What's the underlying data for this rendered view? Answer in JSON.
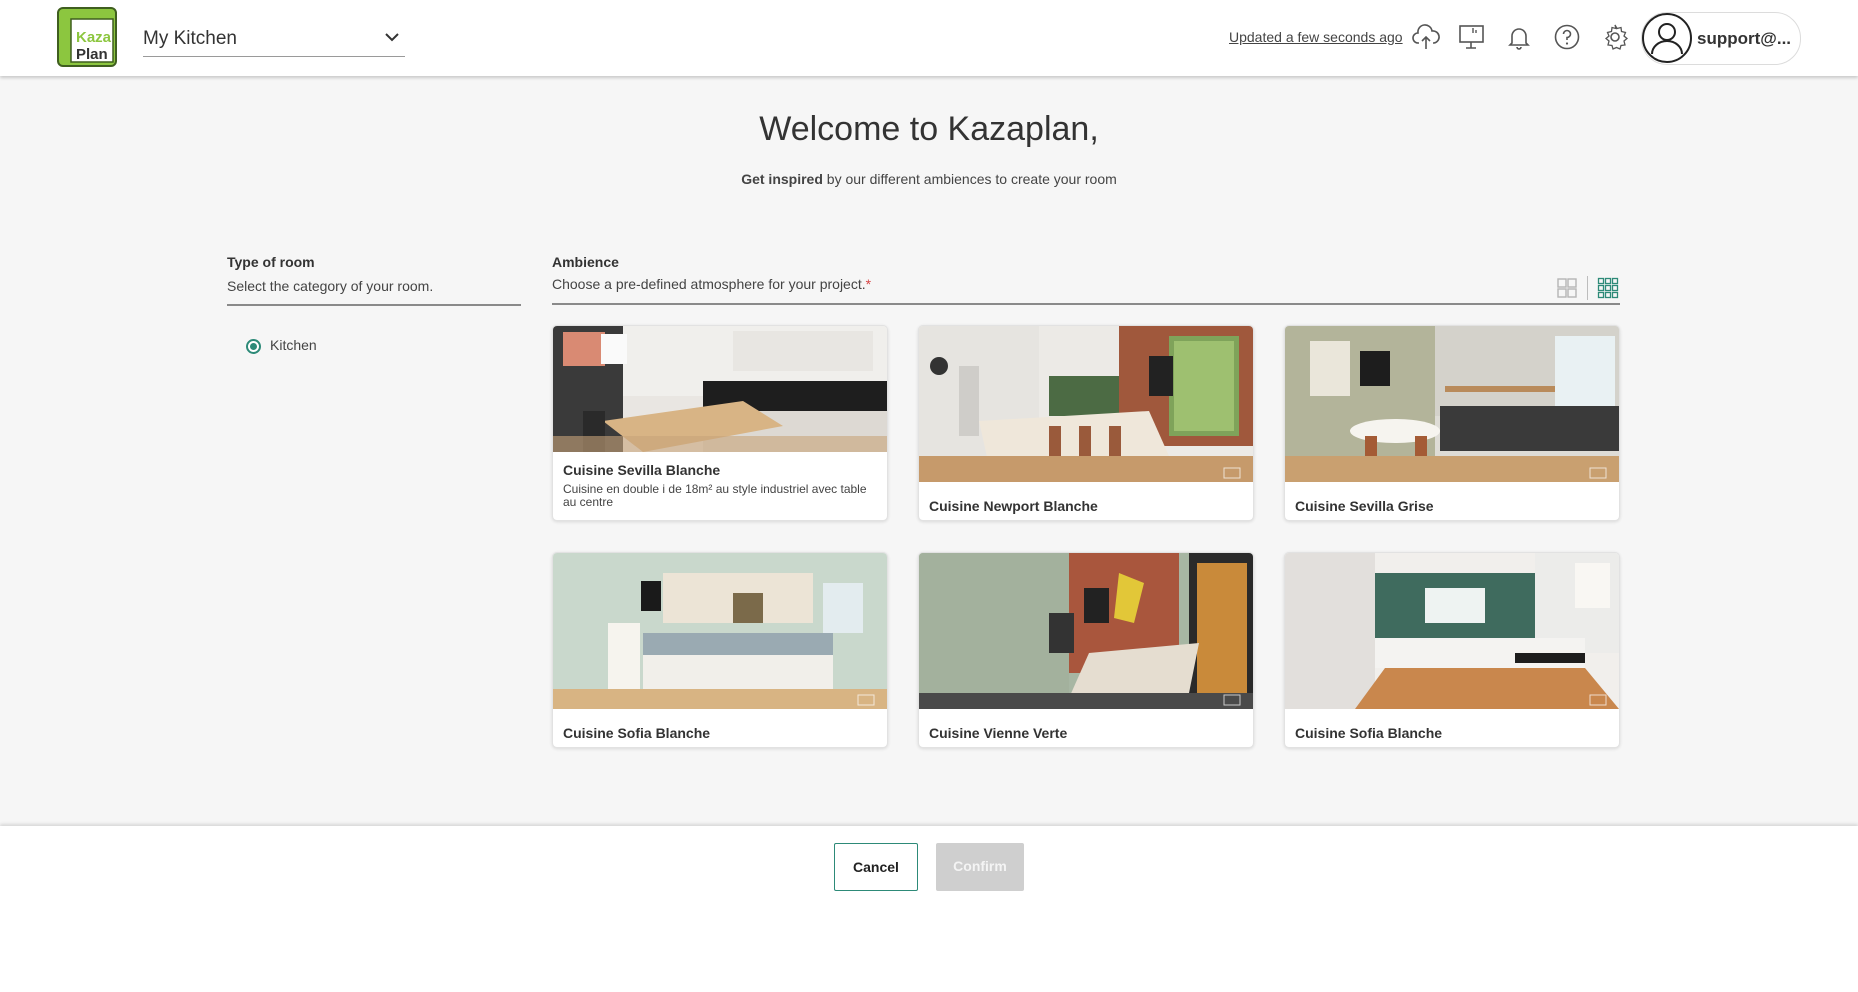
{
  "header": {
    "project_name": "My Kitchen",
    "status": "Updated a few seconds ago",
    "user": "support@...",
    "logo_text_top": "Kaza",
    "logo_text_bottom": "Plan",
    "brand_green": "#8cc63f"
  },
  "welcome": {
    "title": "Welcome to Kazaplan,",
    "subtitle_bold": "Get inspired",
    "subtitle_rest": " by our different ambiences to create your room"
  },
  "room": {
    "title": "Type of room",
    "description": "Select the category of your room.",
    "options": [
      {
        "label": "Kitchen",
        "selected": true
      }
    ]
  },
  "ambience": {
    "title": "Ambience",
    "description": "Choose a pre-defined atmosphere for your project.",
    "required_mark": "*",
    "cards": [
      {
        "title": "Cuisine Sevilla Blanche",
        "description": "Cuisine en double i de 18m² au style industriel avec table au centre"
      },
      {
        "title": "Cuisine Newport Blanche",
        "description": ""
      },
      {
        "title": "Cuisine Sevilla Grise",
        "description": ""
      },
      {
        "title": "Cuisine Sofia Blanche",
        "description": ""
      },
      {
        "title": "Cuisine Vienne Verte",
        "description": ""
      },
      {
        "title": "Cuisine Sofia Blanche",
        "description": ""
      }
    ]
  },
  "footer": {
    "cancel": "Cancel",
    "confirm": "Confirm"
  },
  "colors": {
    "accent": "#2d8a78",
    "required": "#d64545",
    "disabled": "#cfcfcf"
  }
}
